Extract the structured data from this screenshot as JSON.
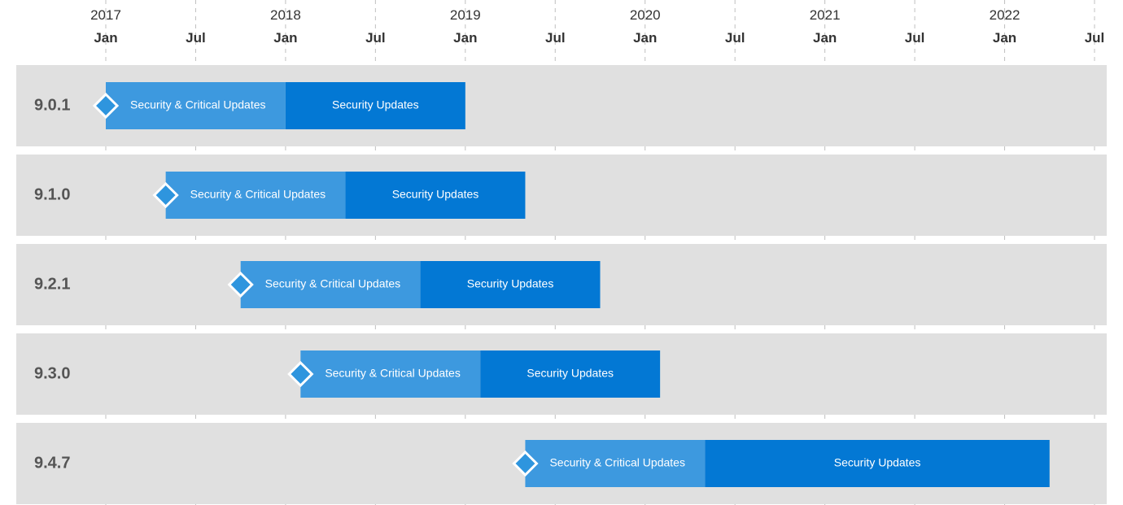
{
  "chart_data": {
    "type": "gantt",
    "title": "",
    "time_axis": {
      "start": "2017-01",
      "end": "2022-07",
      "years": [
        {
          "year": "2017",
          "months": [
            "Jan",
            "Jul"
          ]
        },
        {
          "year": "2018",
          "months": [
            "Jan",
            "Jul"
          ]
        },
        {
          "year": "2019",
          "months": [
            "Jan",
            "Jul"
          ]
        },
        {
          "year": "2020",
          "months": [
            "Jan",
            "Jul"
          ]
        },
        {
          "year": "2021",
          "months": [
            "Jan",
            "Jul"
          ]
        },
        {
          "year": "2022",
          "months": [
            "Jan",
            "Jul"
          ]
        }
      ]
    },
    "phase_labels": {
      "critical": "Security & Critical Updates",
      "security": "Security Updates"
    },
    "rows": [
      {
        "label": "9.0.1",
        "release_month": 0,
        "critical_start": 0,
        "critical_end": 12,
        "security_start": 12,
        "security_end": 24
      },
      {
        "label": "9.1.0",
        "release_month": 4,
        "critical_start": 4,
        "critical_end": 16,
        "security_start": 16,
        "security_end": 28
      },
      {
        "label": "9.2.1",
        "release_month": 9,
        "critical_start": 9,
        "critical_end": 21,
        "security_start": 21,
        "security_end": 33
      },
      {
        "label": "9.3.0",
        "release_month": 13,
        "critical_start": 13,
        "critical_end": 25,
        "security_start": 25,
        "security_end": 37
      },
      {
        "label": "9.4.7",
        "release_month": 28,
        "critical_start": 28,
        "critical_end": 40,
        "security_start": 40,
        "security_end": 63
      }
    ]
  }
}
